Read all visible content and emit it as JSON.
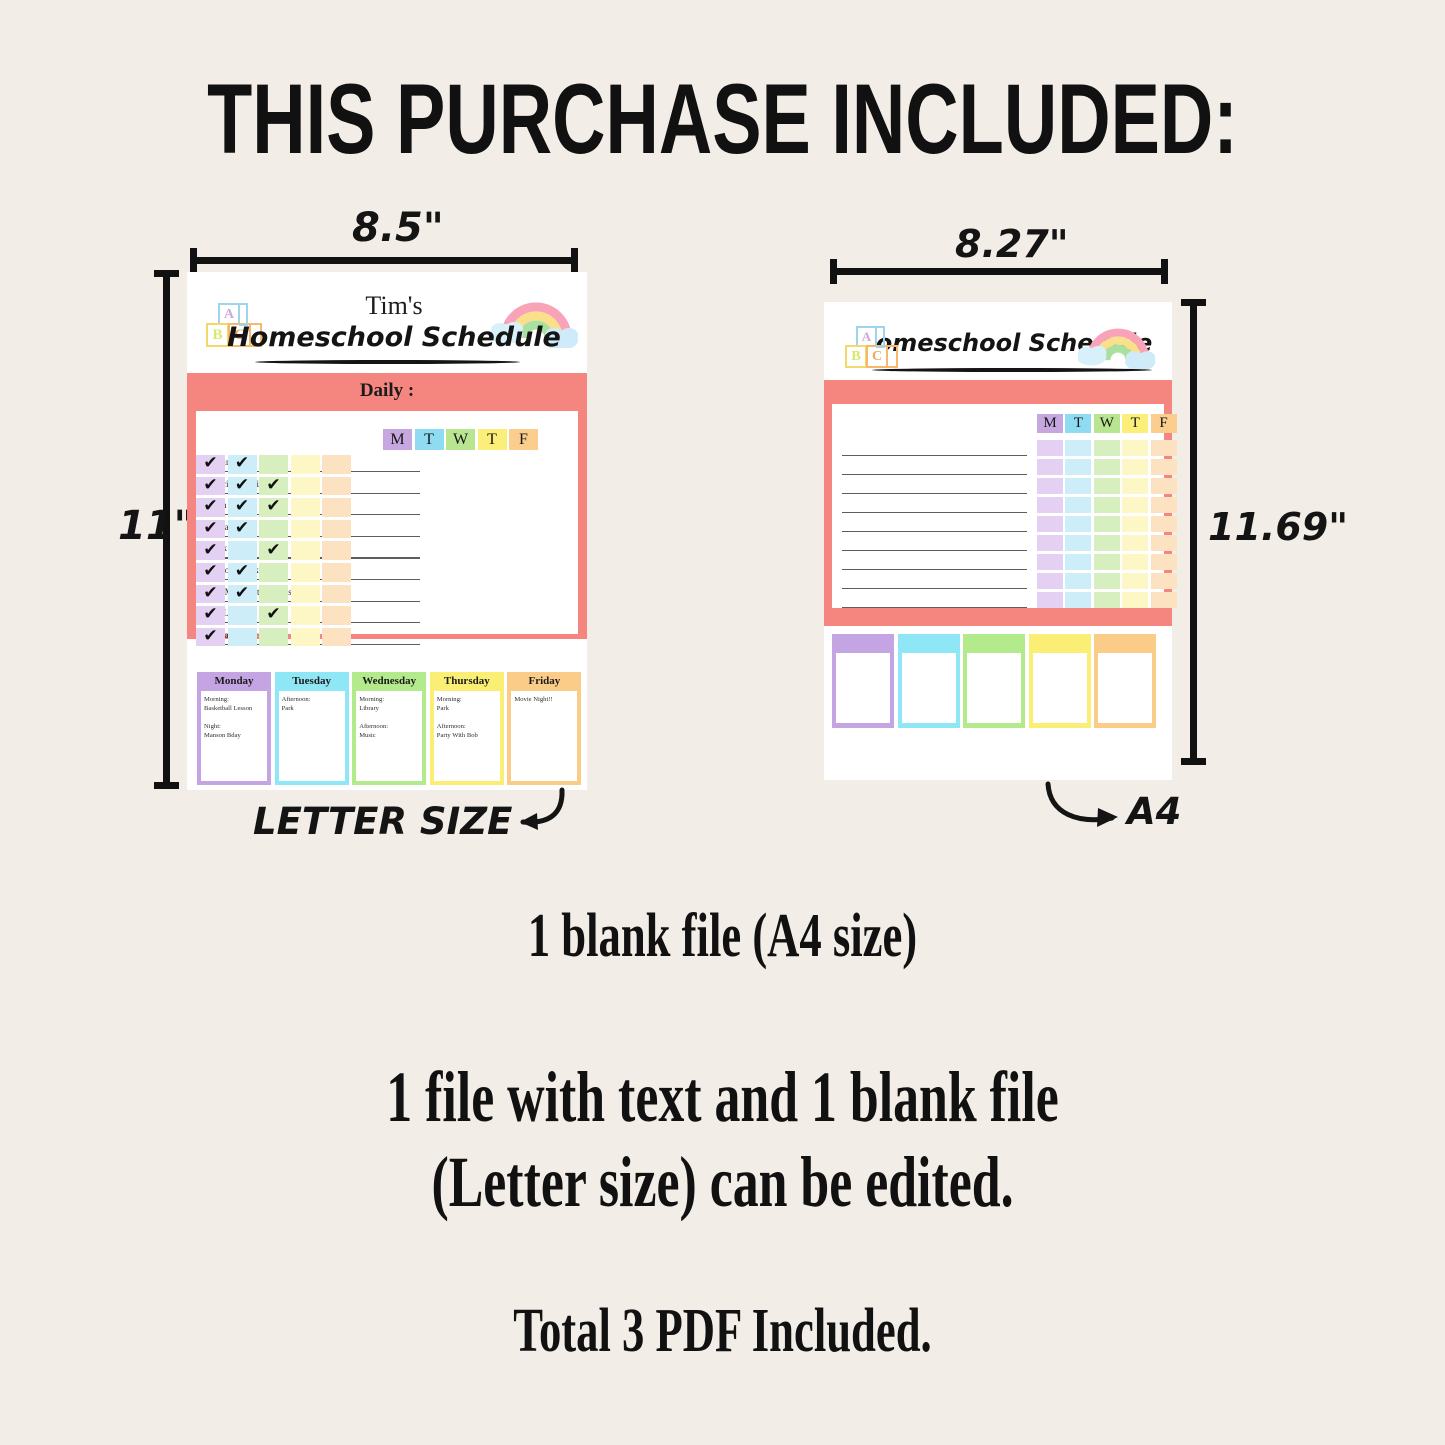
{
  "headline": "THIS PURCHASE INCLUDED:",
  "background_color": "#f2ede6",
  "accent_color": "#f5867f",
  "letter_sheet": {
    "width_label": "8.5\"",
    "height_label": "11\"",
    "caption": "LETTER SIZE",
    "logo_blocks": [
      "A",
      "B",
      "C"
    ],
    "title_name": "Tim's",
    "title_main": "Homeschool Schedule",
    "section_title": "Daily :",
    "day_headers": [
      "M",
      "T",
      "W",
      "T",
      "F"
    ],
    "tasks": [
      {
        "label": "Reading",
        "checks": [
          true,
          true,
          false,
          false,
          false
        ]
      },
      {
        "label": "Exercise 20 mins",
        "checks": [
          true,
          true,
          true,
          false,
          false
        ]
      },
      {
        "label": "Brush Hair",
        "checks": [
          true,
          true,
          true,
          false,
          false
        ]
      },
      {
        "label": "Take a Nap",
        "checks": [
          true,
          true,
          false,
          false,
          false
        ]
      },
      {
        "label": "Snack Time",
        "checks": [
          true,
          false,
          true,
          false,
          false
        ]
      },
      {
        "label": "Do Homework",
        "checks": [
          true,
          true,
          false,
          false,
          false
        ]
      },
      {
        "label": "Help Mom With Chores",
        "checks": [
          true,
          true,
          false,
          false,
          false
        ]
      },
      {
        "label": "iPad Learning",
        "checks": [
          true,
          false,
          true,
          false,
          false
        ]
      },
      {
        "label": "Take a Shower",
        "checks": [
          true,
          false,
          false,
          false,
          false
        ]
      }
    ],
    "days": [
      {
        "name": "Monday",
        "notes": "Morning:\nBasketball Lesson\n\nNight:\nManson Bday"
      },
      {
        "name": "Tuesday",
        "notes": "Afternoon:\nPark"
      },
      {
        "name": "Wednesday",
        "notes": "Morning:\nLibrary\n\nAfternoon:\nMusic"
      },
      {
        "name": "Thursday",
        "notes": "Morning:\nPark\n\nAfternoon:\nParty With Bob"
      },
      {
        "name": "Friday",
        "notes": "Movie Night!!"
      }
    ]
  },
  "a4_sheet": {
    "width_label": "8.27\"",
    "height_label": "11.69\"",
    "caption": "A4",
    "logo_blocks": [
      "A",
      "B",
      "C"
    ],
    "title_main": "Homeschool Schedule",
    "day_headers": [
      "M",
      "T",
      "W",
      "T",
      "F"
    ],
    "blank_row_count": 9,
    "blank_day_box_count": 5
  },
  "palette": {
    "header_cells": [
      "#c7a7e0",
      "#8fdcf2",
      "#b9e490",
      "#fbef7a",
      "#fbce8e"
    ],
    "body_cells": [
      "#e3d0f2",
      "#cdeef9",
      "#d7efbf",
      "#fcf7c4",
      "#fde2c2"
    ],
    "day_box": [
      "#c4a4e2",
      "#8fe6f5",
      "#b3eb8c",
      "#fbee74",
      "#fbcb88"
    ]
  },
  "copy_lines": [
    "1 blank file (A4 size)",
    "1 file with text and 1 blank file\n(Letter size) can be edited.",
    "Total 3 PDF Included."
  ]
}
